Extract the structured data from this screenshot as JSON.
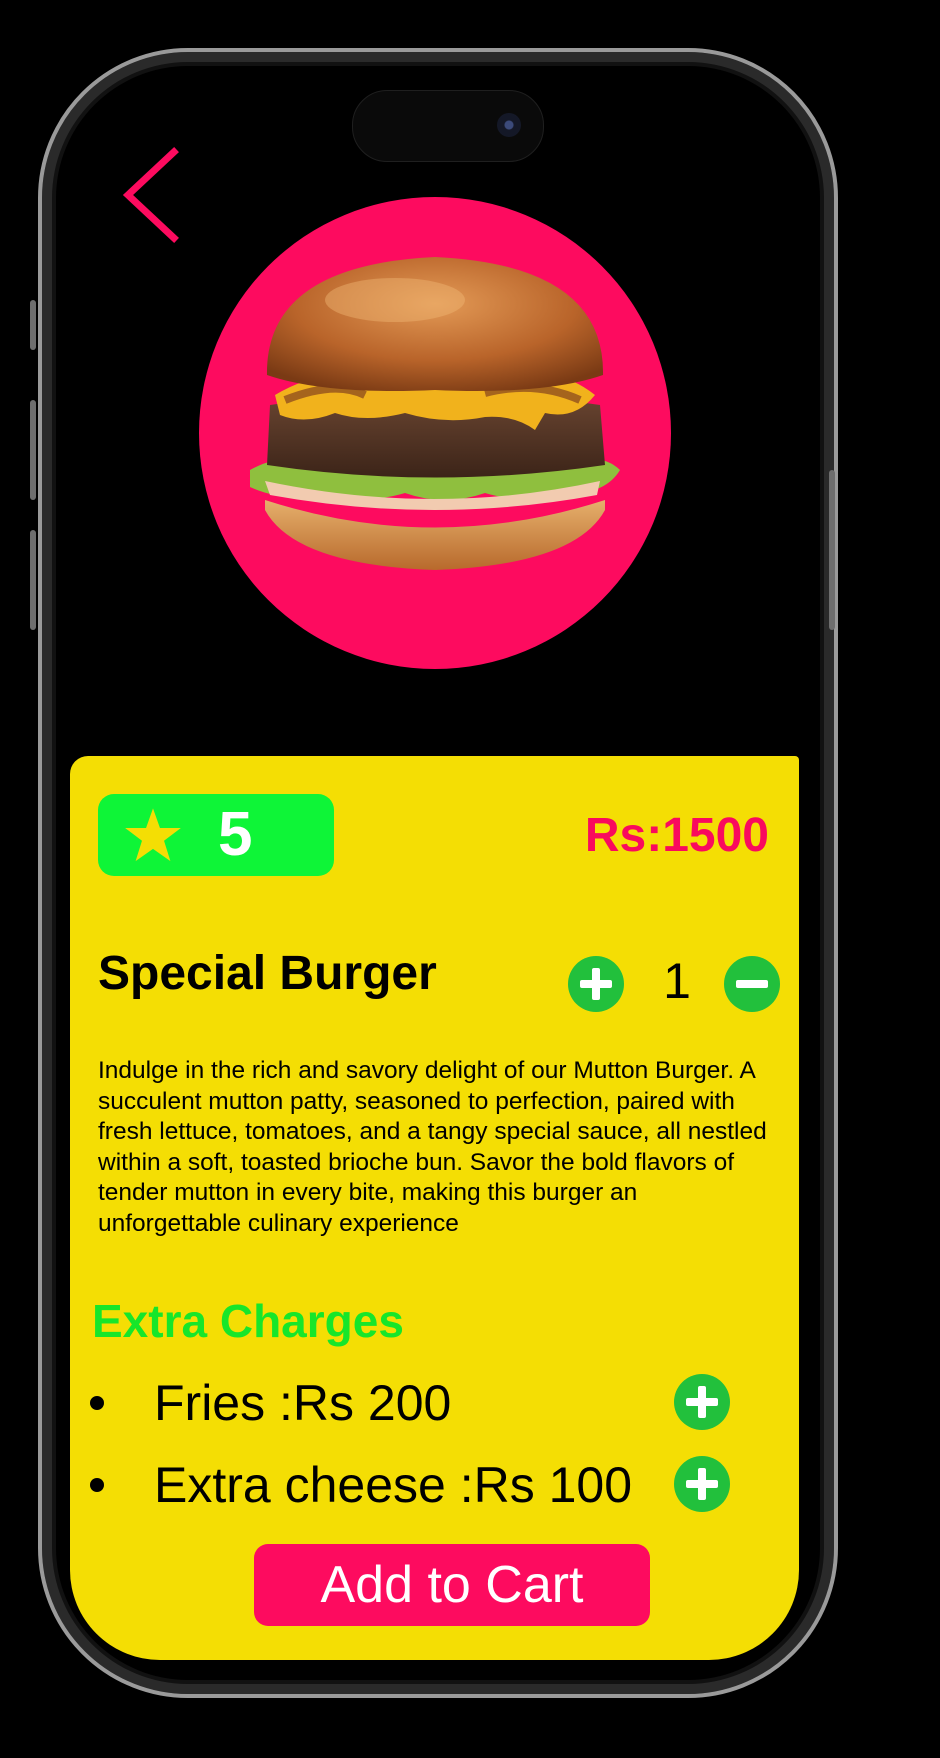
{
  "product": {
    "rating": "5",
    "price": "Rs:1500",
    "name": "Special Burger",
    "quantity": "1",
    "description": "Indulge in the rich and savory delight of our Mutton Burger. A succulent mutton patty, seasoned to perfection, paired with fresh lettuce, tomatoes, and a tangy special sauce, all nestled within a soft, toasted brioche bun. Savor the bold flavors of tender mutton in every bite, making this burger an unforgettable culinary experience"
  },
  "extras": {
    "heading": "Extra Charges",
    "items": [
      {
        "label": "Fries :Rs 200"
      },
      {
        "label": "Extra cheese :Rs 100"
      }
    ]
  },
  "actions": {
    "add_to_cart": "Add to Cart"
  },
  "icons": {
    "back": "chevron-left-icon",
    "rating": "star-icon",
    "increase": "plus-circle-icon",
    "decrease": "minus-circle-icon",
    "add_extra": "plus-circle-icon"
  },
  "colors": {
    "accent_pink": "#fd0b5f",
    "card_yellow": "#f4de04",
    "rating_green": "#0ef537",
    "icon_green": "#22c03c",
    "heading_green": "#17e62a"
  }
}
